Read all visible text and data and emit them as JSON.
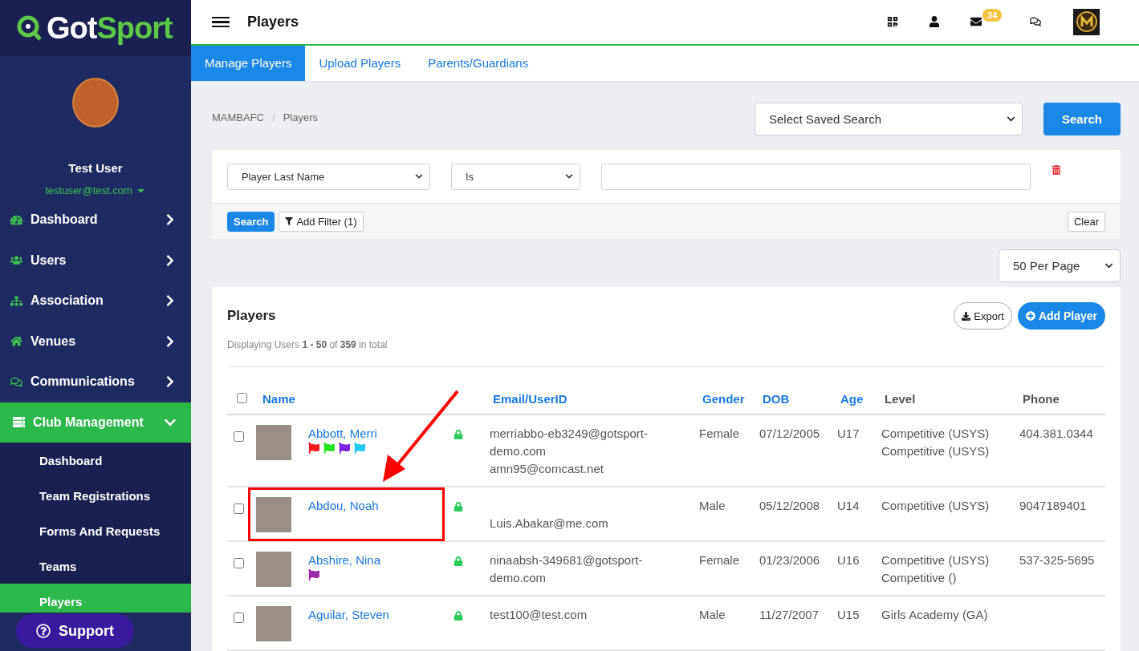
{
  "sidebar": {
    "logo": {
      "part_1": "Got",
      "part_2": "Sport"
    },
    "user": {
      "name": "Test User",
      "email": "testuser@test.com"
    },
    "nav": [
      {
        "label": "Dashboard",
        "expanded": false,
        "selected": false
      },
      {
        "label": "Users",
        "expanded": false,
        "selected": false
      },
      {
        "label": "Association",
        "expanded": false,
        "selected": false
      },
      {
        "label": "Venues",
        "expanded": false,
        "selected": false
      },
      {
        "label": "Communications",
        "expanded": false,
        "selected": false
      },
      {
        "label": "Club Management",
        "expanded": true,
        "selected": true,
        "children": [
          {
            "label": "Dashboard",
            "selected": false
          },
          {
            "label": "Team Registrations",
            "selected": false
          },
          {
            "label": "Forms And Requests",
            "selected": false
          },
          {
            "label": "Teams",
            "selected": false
          },
          {
            "label": "Players",
            "selected": true
          }
        ]
      }
    ],
    "support_button": "Support"
  },
  "topbar": {
    "title": "Players",
    "mail_count": "34"
  },
  "tabs": [
    {
      "label": "Manage Players",
      "selected": true
    },
    {
      "label": "Upload Players",
      "selected": false
    },
    {
      "label": "Parents/Guardians",
      "selected": false
    }
  ],
  "breadcrumb": {
    "separator": "/",
    "items": [
      "MAMBAFC",
      "Players"
    ]
  },
  "saved_search": {
    "value": "Select Saved Search",
    "button": "Search"
  },
  "filter": {
    "field": "Player Last Name",
    "operator": "Is",
    "search_button": "Search",
    "add_filter_button": "Add Filter (1)",
    "clear_button": "Clear"
  },
  "per_page": "50 Per Page",
  "players_card": {
    "title": "Players",
    "export_button": "Export",
    "add_button": "Add Player",
    "summary": "Displaying Users **1 - 50** of **359** in total"
  },
  "table": {
    "select_all_checked": false,
    "columns": [
      {
        "label": "Name",
        "sortable": true
      },
      {
        "label": "Email/UserID",
        "sortable": true
      },
      {
        "label": "Gender",
        "sortable": true
      },
      {
        "label": "DOB",
        "sortable": true
      },
      {
        "label": "Age",
        "sortable": true
      },
      {
        "label": "Level",
        "sortable": false
      },
      {
        "label": "Phone",
        "sortable": false
      }
    ],
    "rows": [
      {
        "checked": false,
        "name": "Abbott, Merri",
        "flags": [
          {
            "color": "#ff1a1a"
          },
          {
            "color": "#22e622"
          },
          {
            "color": "#7a22e6"
          },
          {
            "color": "#22c8f0"
          }
        ],
        "user_id": "merriabbo-eb3249@gotsport-demo.com",
        "email": "amn95@comcast.net",
        "gender": "Female",
        "dob": "07/12/2005",
        "age": "U17",
        "levels": [
          "Competitive (USYS)",
          "Competitive (USYS)"
        ],
        "phone": "404.381.0344",
        "highlighted": false
      },
      {
        "checked": false,
        "name": "Abdou, Noah",
        "flags": [],
        "email": "Luis.Abakar@me.com",
        "gender": "Male",
        "dob": "05/12/2008",
        "age": "U14",
        "levels": [
          "Competitive (USYS)"
        ],
        "phone": "9047189401",
        "highlighted": true
      },
      {
        "checked": false,
        "name": "Abshire, Nina",
        "flags": [
          {
            "color": "#9b2aa8"
          }
        ],
        "user_id": "ninaabsh-349681@gotsport-demo.com",
        "gender": "Female",
        "dob": "01/23/2006",
        "age": "U16",
        "levels": [
          "Competitive (USYS)",
          "Competitive ()"
        ],
        "phone": "537-325-5695",
        "highlighted": false
      },
      {
        "checked": false,
        "name": "Aguilar, Steven",
        "flags": [],
        "user_id": "test100@test.com",
        "gender": "Male",
        "dob": "11/27/2007",
        "age": "U15",
        "levels": [
          "Girls Academy (GA)"
        ],
        "highlighted": false
      }
    ]
  }
}
